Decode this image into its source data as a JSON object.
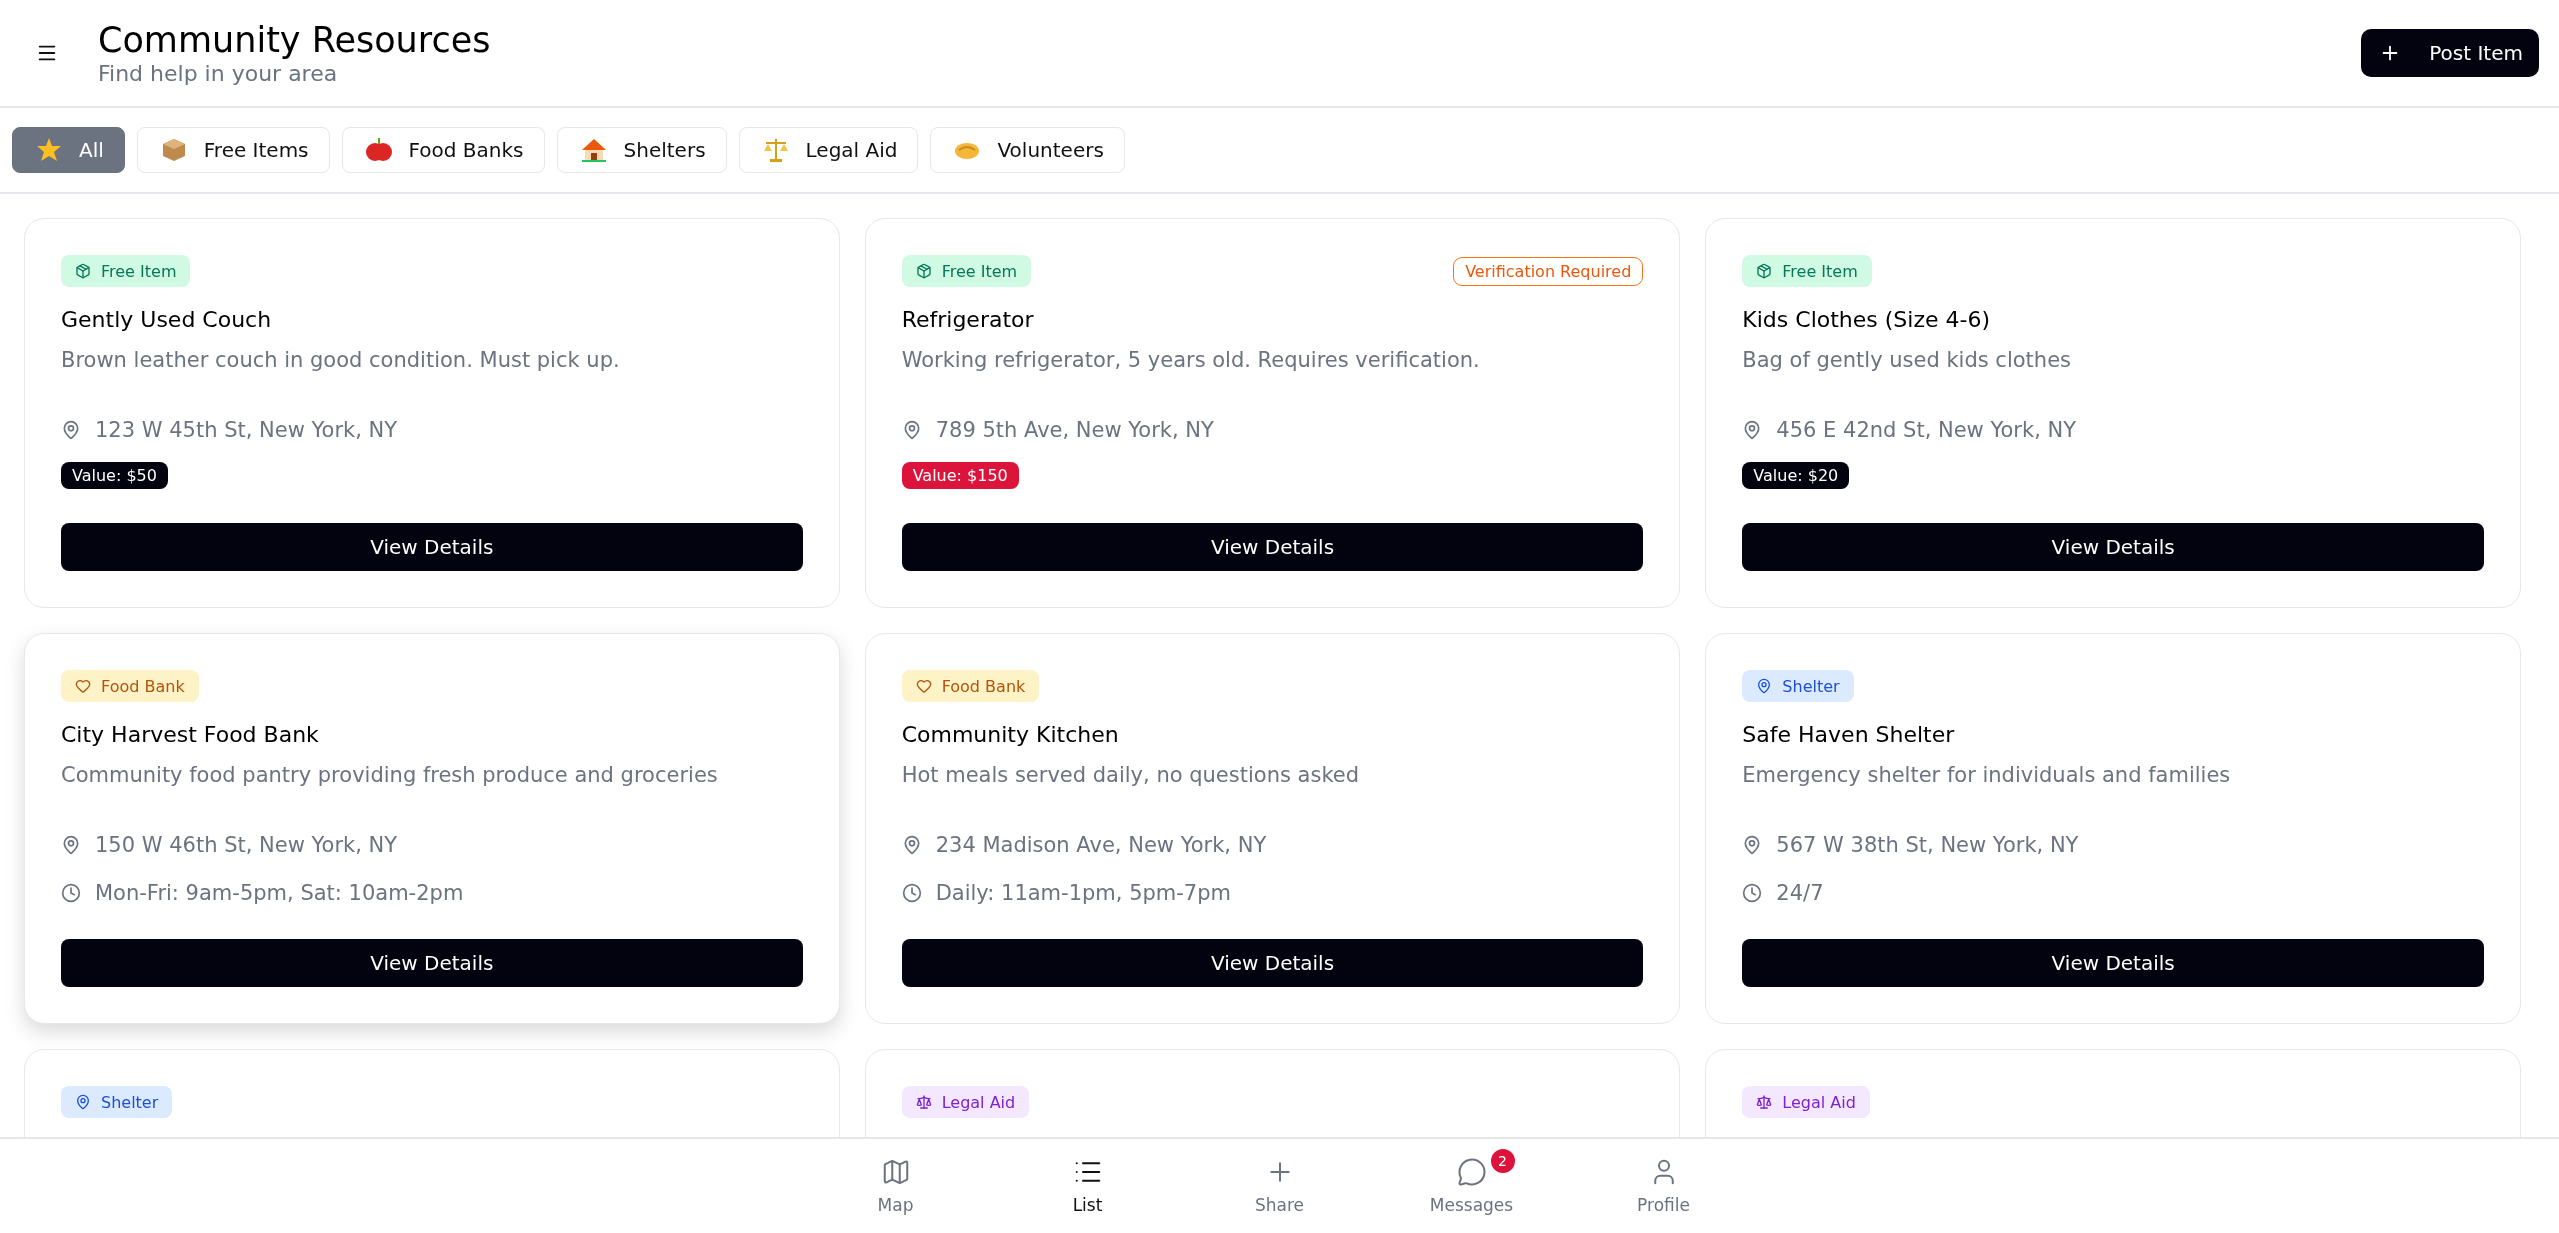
{
  "header": {
    "title": "Community Resources",
    "subtitle": "Find help in your area",
    "post_button": "Post Item"
  },
  "filters": [
    {
      "kind": "all",
      "label": "All",
      "selected": true
    },
    {
      "kind": "free-items",
      "label": "Free Items",
      "selected": false
    },
    {
      "kind": "food-banks",
      "label": "Food Banks",
      "selected": false
    },
    {
      "kind": "shelters",
      "label": "Shelters",
      "selected": false
    },
    {
      "kind": "legal-aid",
      "label": "Legal Aid",
      "selected": false
    },
    {
      "kind": "volunteers",
      "label": "Volunteers",
      "selected": false
    }
  ],
  "cards": [
    {
      "kind": "free-item",
      "tag": "Free Item",
      "title": "Gently Used Couch",
      "description": "Brown leather couch in good condition. Must pick up.",
      "address": "123 W 45th St, New York, NY",
      "value": "Value: $50",
      "value_warning": false,
      "button": "View Details",
      "hovered": false
    },
    {
      "kind": "free-item",
      "tag": "Free Item",
      "notice": "Verification Required",
      "title": "Refrigerator",
      "description": "Working refrigerator, 5 years old. Requires verification.",
      "address": "789 5th Ave, New York, NY",
      "value": "Value: $150",
      "value_warning": true,
      "button": "View Details",
      "hovered": false
    },
    {
      "kind": "free-item",
      "tag": "Free Item",
      "title": "Kids Clothes (Size 4-6)",
      "description": "Bag of gently used kids clothes",
      "address": "456 E 42nd St, New York, NY",
      "value": "Value: $20",
      "value_warning": false,
      "button": "View Details",
      "hovered": false
    },
    {
      "kind": "food-bank",
      "tag": "Food Bank",
      "title": "City Harvest Food Bank",
      "description": "Community food pantry providing fresh produce and groceries",
      "address": "150 W 46th St, New York, NY",
      "hours": "Mon-Fri: 9am-5pm, Sat: 10am-2pm",
      "button": "View Details",
      "hovered": true
    },
    {
      "kind": "food-bank",
      "tag": "Food Bank",
      "title": "Community Kitchen",
      "description": "Hot meals served daily, no questions asked",
      "address": "234 Madison Ave, New York, NY",
      "hours": "Daily: 11am-1pm, 5pm-7pm",
      "button": "View Details",
      "hovered": false
    },
    {
      "kind": "shelter",
      "tag": "Shelter",
      "title": "Safe Haven Shelter",
      "description": "Emergency shelter for individuals and families",
      "address": "567 W 38th St, New York, NY",
      "hours": "24/7",
      "button": "View Details",
      "hovered": false
    },
    {
      "kind": "shelter",
      "tag": "Shelter",
      "hovered": false
    },
    {
      "kind": "legal-aid",
      "tag": "Legal Aid",
      "hovered": false
    },
    {
      "kind": "legal-aid",
      "tag": "Legal Aid",
      "hovered": false
    }
  ],
  "bottom_nav": [
    {
      "kind": "map",
      "label": "Map",
      "selected": false
    },
    {
      "kind": "list",
      "label": "List",
      "selected": true
    },
    {
      "kind": "share",
      "label": "Share",
      "selected": false
    },
    {
      "kind": "messages",
      "label": "Messages",
      "badge": "2",
      "selected": false
    },
    {
      "kind": "profile",
      "label": "Profile",
      "selected": false
    }
  ]
}
